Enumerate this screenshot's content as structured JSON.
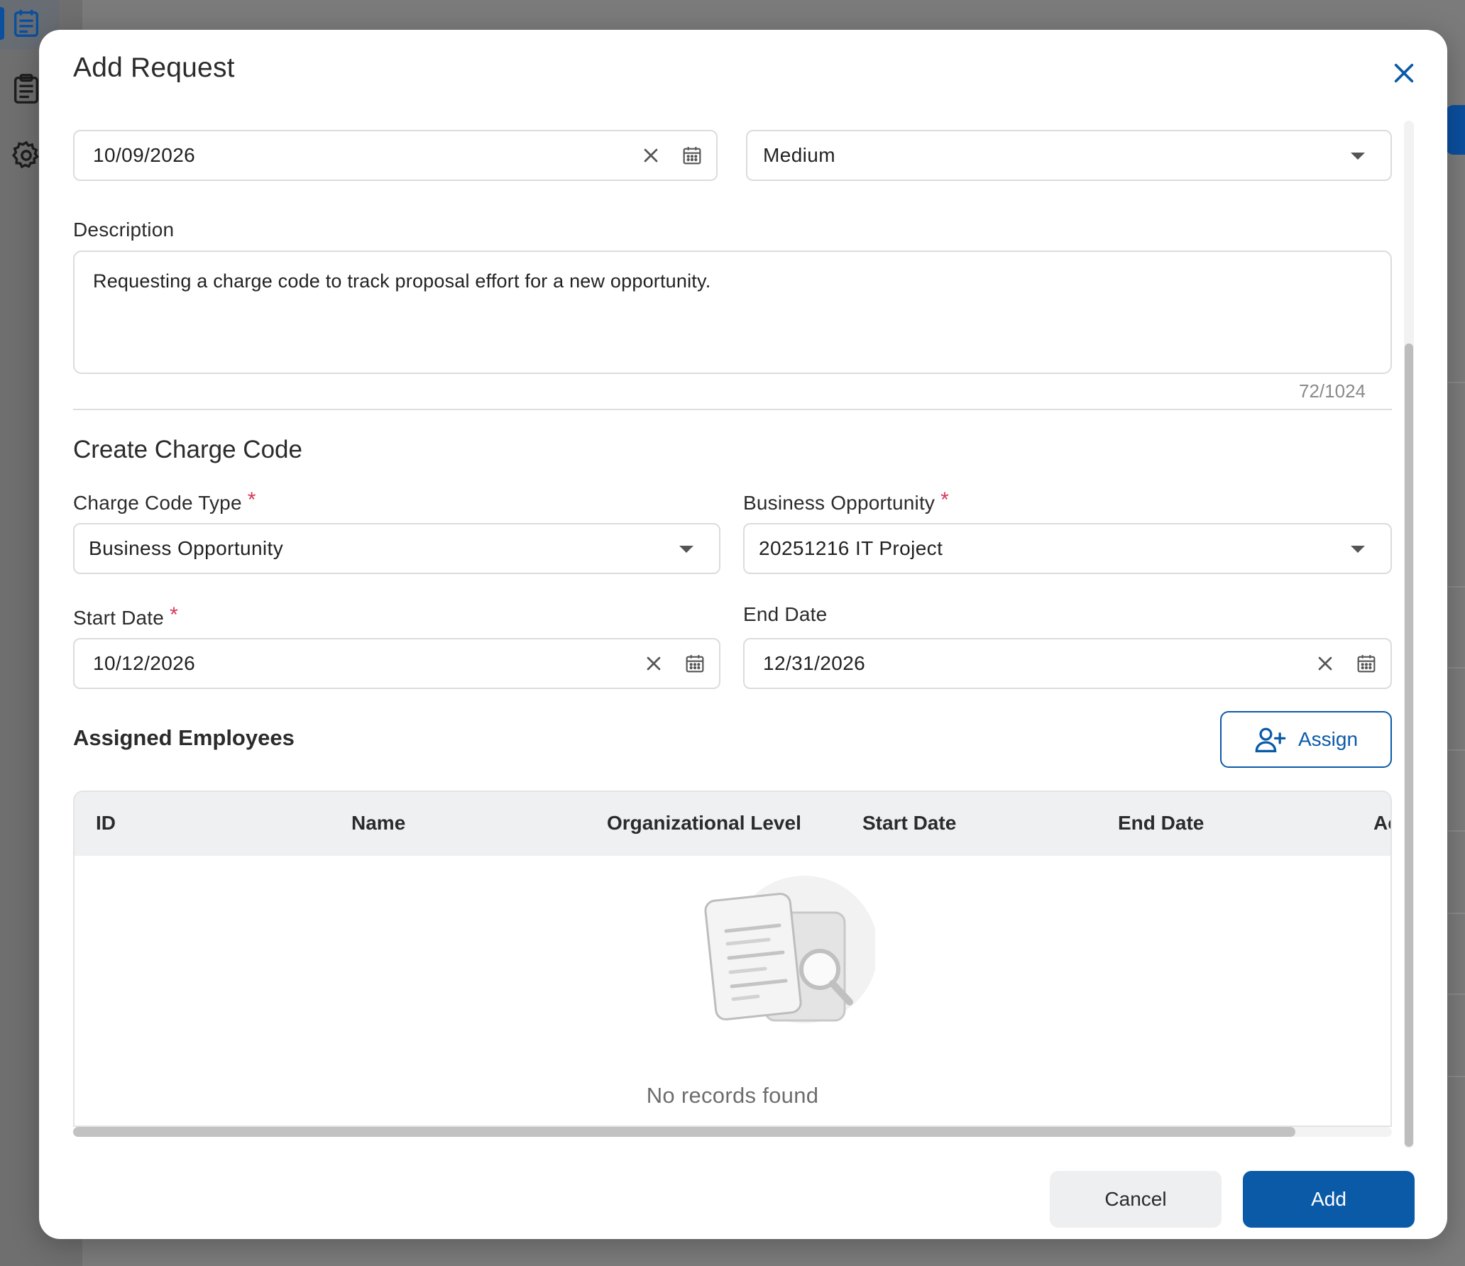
{
  "modal": {
    "title": "Add Request",
    "request_date": "10/09/2026",
    "priority": "Medium",
    "description_label": "Description",
    "description_value": "Requesting a charge code to track proposal effort for a new opportunity.",
    "description_counter": "72/1024"
  },
  "charge_code": {
    "section_title": "Create Charge Code",
    "type_label": "Charge Code Type",
    "type_value": "Business Opportunity",
    "opportunity_label": "Business Opportunity",
    "opportunity_value": "20251216 IT Project",
    "start_label": "Start Date",
    "start_value": "10/12/2026",
    "end_label": "End Date",
    "end_value": "12/31/2026",
    "required_mark": "*"
  },
  "employees": {
    "title": "Assigned Employees",
    "assign_label": "Assign",
    "columns": [
      "ID",
      "Name",
      "Organizational Level",
      "Start Date",
      "End Date",
      "Ac"
    ],
    "empty_text": "No records found"
  },
  "footer": {
    "cancel_label": "Cancel",
    "add_label": "Add"
  },
  "colors": {
    "primary": "#0b5aa8",
    "required": "#d43b5a"
  },
  "icons": {
    "close": "close-icon",
    "calendar": "calendar-icon",
    "clear": "clear-icon",
    "dropdown": "chevron-down-icon",
    "assign": "add-user-icon",
    "empty": "no-records-illustration"
  }
}
